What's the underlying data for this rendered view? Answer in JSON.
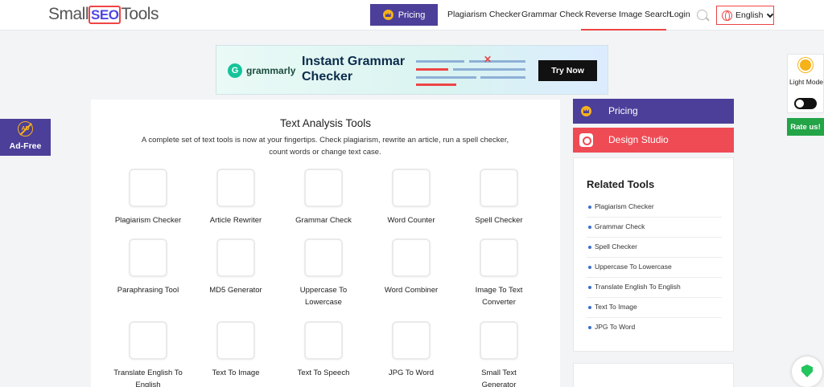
{
  "header": {
    "logo": {
      "part1": "Small",
      "part2": "SEO",
      "part3": "Tools"
    },
    "pricing_label": "Pricing",
    "nav": [
      "Plagiarism Checker",
      "Grammar Check",
      "Reverse Image Search",
      "Login"
    ],
    "language": "English"
  },
  "ad": {
    "brand": "grammarly",
    "title": "Instant Grammar Checker",
    "cta": "Try Now"
  },
  "adfree": {
    "icon_text": "AD",
    "label": "Ad-Free"
  },
  "main": {
    "title": "Text Analysis Tools",
    "description": "A complete set of text tools is now at your fingertips. Check plagiarism, rewrite an article, run a spell checker, count words or change text case.",
    "tools": [
      "Plagiarism Checker",
      "Article Rewriter",
      "Grammar Check",
      "Word Counter",
      "Spell Checker",
      "Paraphrasing Tool",
      "MD5 Generator",
      "Uppercase To Lowercase",
      "Word Combiner",
      "Image To Text Converter",
      "Translate English To English",
      "Text To Image",
      "Text To Speech",
      "JPG To Word",
      "Small Text Generator"
    ]
  },
  "sidebar": {
    "pricing": "Pricing",
    "design_studio": "Design Studio",
    "related_title": "Related Tools",
    "related": [
      "Plagiarism Checker",
      "Grammar Check",
      "Spell Checker",
      "Uppercase To Lowercase",
      "Translate English To English",
      "Text To Image",
      "JPG To Word"
    ]
  },
  "widgets": {
    "light_mode": "Light Mode",
    "rate_us": "Rate us!"
  },
  "colors": {
    "brand_purple": "#4c3f99",
    "accent_red": "#ef4b55",
    "green": "#22a447"
  }
}
